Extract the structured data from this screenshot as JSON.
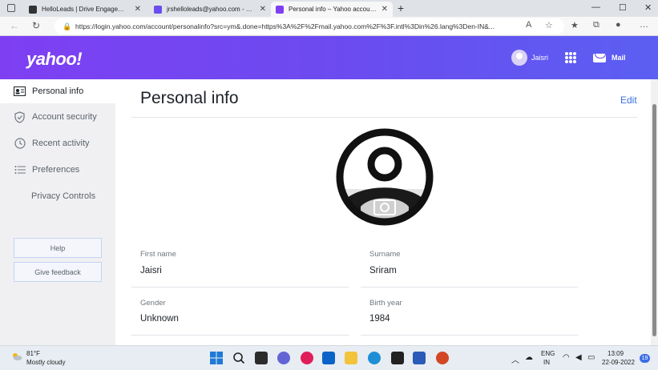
{
  "browser": {
    "tabs": [
      {
        "title": "HelloLeads | Drive Engagement",
        "favicon": "helloleads-icon",
        "color": "#333333"
      },
      {
        "title": "jrshelloleads@yahoo.com - Yahoo",
        "favicon": "yahoo-mail-icon",
        "color": "#6a4cf0"
      },
      {
        "title": "Personal info – Yahoo account se",
        "favicon": "yahoo-icon",
        "color": "#7e3ff2"
      }
    ],
    "url": "https://login.yahoo.com/account/personalinfo?src=ym&.done=https%3A%2F%2Fmail.yahoo.com%2F%3F.intl%3Din%26.lang%3Den-IN&..."
  },
  "header": {
    "logo": "yahoo!",
    "user_name": "Jaisri",
    "mail_label": "Mail"
  },
  "sidebar": {
    "items": [
      {
        "label": "Personal info",
        "icon": "id-card-icon"
      },
      {
        "label": "Account security",
        "icon": "shield-icon"
      },
      {
        "label": "Recent activity",
        "icon": "clock-icon"
      },
      {
        "label": "Preferences",
        "icon": "list-icon"
      },
      {
        "label": "Privacy Controls",
        "icon": ""
      }
    ],
    "help_label": "Help",
    "feedback_label": "Give feedback"
  },
  "main": {
    "title": "Personal info",
    "edit_label": "Edit",
    "fields": {
      "first_name": {
        "label": "First name",
        "value": "Jaisri"
      },
      "surname": {
        "label": "Surname",
        "value": "Sriram"
      },
      "gender": {
        "label": "Gender",
        "value": "Unknown"
      },
      "birth_year": {
        "label": "Birth year",
        "value": "1984"
      }
    }
  },
  "taskbar": {
    "weather_temp": "81°F",
    "weather_cond": "Mostly cloudy",
    "lang_top": "ENG",
    "lang_bottom": "IN",
    "time": "13:09",
    "date": "22-09-2022",
    "notif_count": "19"
  }
}
